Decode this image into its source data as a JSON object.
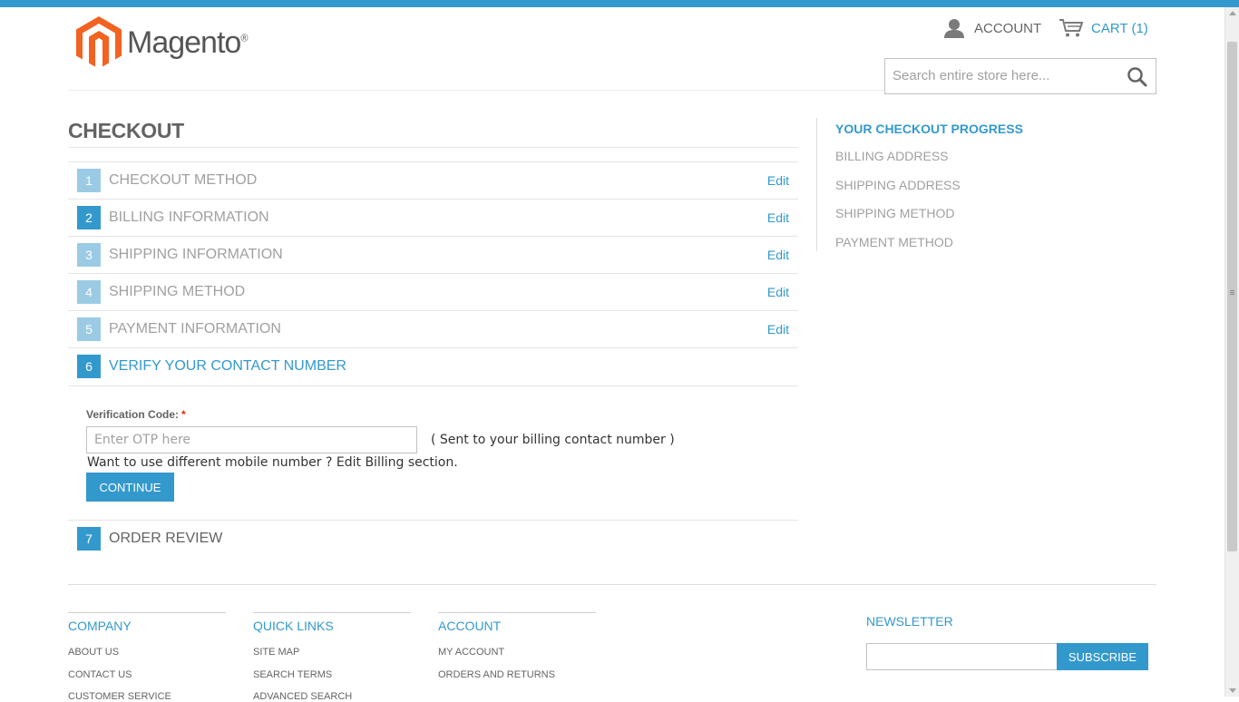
{
  "brand": {
    "name": "Magento",
    "mark": "®",
    "color": "#f26322"
  },
  "header": {
    "account_label": "ACCOUNT",
    "cart_label": "CART (1)",
    "search": {
      "placeholder": "Search entire store here..."
    }
  },
  "page": {
    "title": "CHECKOUT"
  },
  "steps": [
    {
      "number": "1",
      "title": "CHECKOUT METHOD",
      "edit": "Edit"
    },
    {
      "number": "2",
      "title": "BILLING INFORMATION",
      "edit": "Edit"
    },
    {
      "number": "3",
      "title": "SHIPPING INFORMATION",
      "edit": "Edit"
    },
    {
      "number": "4",
      "title": "SHIPPING METHOD",
      "edit": "Edit"
    },
    {
      "number": "5",
      "title": "PAYMENT INFORMATION",
      "edit": "Edit"
    },
    {
      "number": "6",
      "title": "VERIFY YOUR CONTACT NUMBER"
    },
    {
      "number": "7",
      "title": "ORDER REVIEW"
    }
  ],
  "verify": {
    "label": "Verification Code:",
    "required_mark": "*",
    "placeholder": "Enter OTP here",
    "hint": "( Sent to your billing contact number )",
    "alt_text": "Want to use different mobile number ? Edit Billing section.",
    "button": "CONTINUE"
  },
  "progress": {
    "title": "YOUR CHECKOUT PROGRESS",
    "items": [
      "BILLING ADDRESS",
      "SHIPPING ADDRESS",
      "SHIPPING METHOD",
      "PAYMENT METHOD"
    ]
  },
  "footer": {
    "columns": [
      {
        "title": "COMPANY",
        "links": [
          "ABOUT US",
          "CONTACT US",
          "CUSTOMER SERVICE"
        ]
      },
      {
        "title": "QUICK LINKS",
        "links": [
          "SITE MAP",
          "SEARCH TERMS",
          "ADVANCED SEARCH"
        ]
      },
      {
        "title": "ACCOUNT",
        "links": [
          "MY ACCOUNT",
          "ORDERS AND RETURNS"
        ]
      }
    ],
    "newsletter": {
      "title": "NEWSLETTER",
      "button": "SUBSCRIBE"
    }
  },
  "colors": {
    "accent": "#3399cc",
    "accent_light": "#9bcbe4",
    "text": "#636363",
    "muted": "#a0a0a0"
  },
  "icons": {
    "logo": "magento-logo-icon",
    "account": "user-icon",
    "cart": "cart-icon",
    "search": "search-icon"
  }
}
